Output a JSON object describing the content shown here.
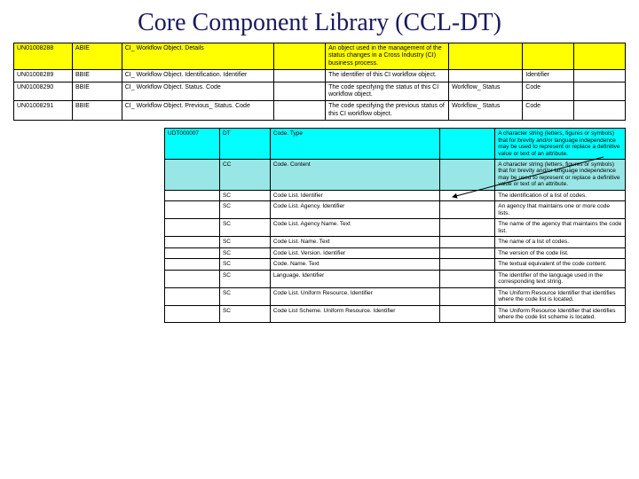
{
  "title": "Core Component Library (CCL-DT)",
  "top": {
    "rows": [
      {
        "id": "UN01008288",
        "type": "ABIE",
        "name": "CI_ Workflow Object. Details",
        "gap": "",
        "desc": "An object used in the management of the status changes in a Cross Industry (CI) business process.",
        "rep": "",
        "dt": "",
        "last": "",
        "hl": "yellow"
      },
      {
        "id": "UN01008289",
        "type": "BBIE",
        "name": "CI_ Workflow Object. Identification. Identifier",
        "gap": "",
        "desc": "The identifier of this CI workflow object.",
        "rep": "",
        "dt": "Identifier",
        "last": ""
      },
      {
        "id": "UN01008290",
        "type": "BBIE",
        "name": "CI_ Workflow Object. Status. Code",
        "gap": "",
        "desc": "The code specifying the status of this CI workflow object.",
        "rep": "Workflow_ Status",
        "dt": "Code",
        "last": ""
      },
      {
        "id": "UN01008291",
        "type": "BBIE",
        "name": "CI_ Workflow Object. Previous_ Status. Code",
        "gap": "",
        "desc": "The code specifying the previous status of this CI workflow object.",
        "rep": "Workflow_ Status",
        "dt": "Code",
        "last": ""
      }
    ]
  },
  "bottom": {
    "rows": [
      {
        "id": "UDT000007",
        "type": "DT",
        "name": "Code. Type",
        "gap": "",
        "desc": "A character string (letters, figures or symbols) that for brevity and/or language independence may be used to represent or replace a definitive value or text of an attribute.",
        "hl": "cyan1"
      },
      {
        "id": "",
        "type": "CC",
        "name": "Code. Content",
        "gap": "",
        "desc": "A character string (letters, figures or symbols) that for brevity and/or language independence may be used to represent or replace a definitive value or text of an attribute.",
        "hl": "cyan2"
      },
      {
        "id": "",
        "type": "SC",
        "name": "Code List. Identifier",
        "gap": "",
        "desc": "The identification of a list of codes."
      },
      {
        "id": "",
        "type": "SC",
        "name": "Code List. Agency. Identifier",
        "gap": "",
        "desc": "An agency that maintains one or more code lists."
      },
      {
        "id": "",
        "type": "SC",
        "name": "Code List. Agency Name. Text",
        "gap": "",
        "desc": "The name of the agency that maintains the code list."
      },
      {
        "id": "",
        "type": "SC",
        "name": "Code List. Name. Text",
        "gap": "",
        "desc": "The name of a list of codes."
      },
      {
        "id": "",
        "type": "SC",
        "name": "Code List. Version. Identifier",
        "gap": "",
        "desc": "The version of the code list."
      },
      {
        "id": "",
        "type": "SC",
        "name": "Code. Name. Text",
        "gap": "",
        "desc": "The textual equivalent of the code content."
      },
      {
        "id": "",
        "type": "SC",
        "name": "Language. Identifier",
        "gap": "",
        "desc": "The identifier of the language used in the corresponding text string."
      },
      {
        "id": "",
        "type": "SC",
        "name": "Code List. Uniform Resource. Identifier",
        "gap": "",
        "desc": "The Uniform Resource Identifier that identifies where the code list is located."
      },
      {
        "id": "",
        "type": "SC",
        "name": "Code List Scheme. Uniform Resource. Identifier",
        "gap": "",
        "desc": "The Uniform Resource Identifier that identifies where the code list scheme is located."
      }
    ]
  }
}
